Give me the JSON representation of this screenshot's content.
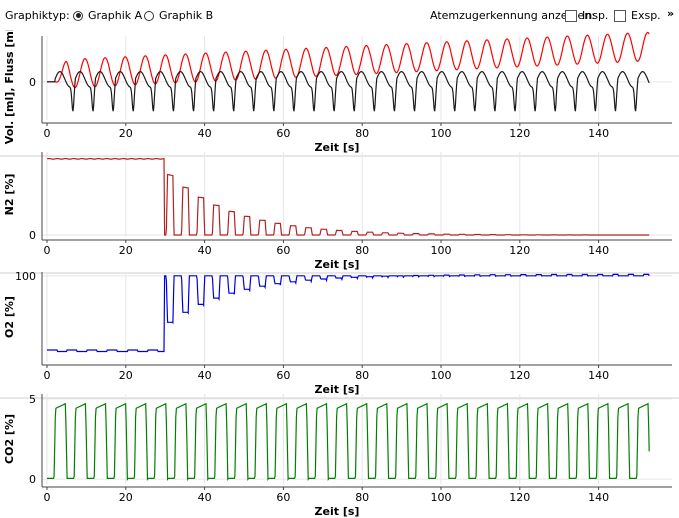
{
  "toolbar": {
    "graph_type_label": "Graphiktyp:",
    "options": [
      {
        "label": "Graphik A",
        "selected": true
      },
      {
        "label": "Graphik B",
        "selected": false
      }
    ],
    "breath_marker_label": "Atemzugerkennung anzeigen:",
    "checkboxes": [
      {
        "label": "Insp.",
        "checked": false
      },
      {
        "label": "Exsp.",
        "checked": false
      }
    ],
    "expand_icon": "double-chevron-down-icon"
  },
  "chart_data": [
    {
      "type": "line",
      "ylabel": "Vol. [ml], Fluss [ml/s]",
      "xlabel": "Zeit [s]",
      "xlim": [
        -1,
        154
      ],
      "xticks": [
        0,
        20,
        40,
        60,
        80,
        100,
        120,
        140
      ],
      "yticks": [
        0
      ],
      "ylim": [
        -0.75,
        0.9
      ],
      "period_s": 5.1,
      "series": [
        {
          "color": "#ff0000",
          "shape": "volume-oscillation",
          "baseline_start": 0.0,
          "baseline_end": 0.55,
          "amplitude": 0.28
        },
        {
          "color": "#1a1a1a",
          "shape": "flow-oscillation",
          "baseline": 0.0,
          "amplitude": 0.3
        }
      ]
    },
    {
      "type": "line",
      "ylabel": "N2 [%]",
      "xlabel": "Zeit [s]",
      "xlim": [
        -1,
        154
      ],
      "xticks": [
        0,
        20,
        40,
        60,
        80,
        100,
        120,
        140
      ],
      "yticks": [
        0
      ],
      "ylim": [
        -2,
        85
      ],
      "washout_start_s": 29.8,
      "series": [
        {
          "color": "#b22222",
          "shape": "n2-washout",
          "plateau": 78,
          "peak_start": 62,
          "decay": 0.06,
          "floor": 0
        }
      ]
    },
    {
      "type": "line",
      "ylabel": "O2 [%]",
      "xlabel": "Zeit [s]",
      "xlim": [
        -1,
        154
      ],
      "xticks": [
        0,
        20,
        40,
        60,
        80,
        100,
        120,
        140
      ],
      "yticks": [
        100
      ],
      "ylim": [
        10,
        104
      ],
      "washout_start_s": 29.8,
      "series": [
        {
          "color": "#0000dd",
          "shape": "o2-washin",
          "pre_level": 21,
          "high": 100,
          "trough_start": 50,
          "recovery": 0.06
        }
      ]
    },
    {
      "type": "line",
      "ylabel": "CO2 [%]",
      "xlabel": "Zeit [s]",
      "xlim": [
        -1,
        154
      ],
      "xticks": [
        0,
        20,
        40,
        60,
        80,
        100,
        120,
        140
      ],
      "yticks": [
        0,
        5
      ],
      "ylim": [
        -0.3,
        5.3
      ],
      "period_s": 5.1,
      "series": [
        {
          "color": "#008000",
          "shape": "capnogram",
          "low": 0,
          "high": 4.7
        }
      ]
    }
  ]
}
